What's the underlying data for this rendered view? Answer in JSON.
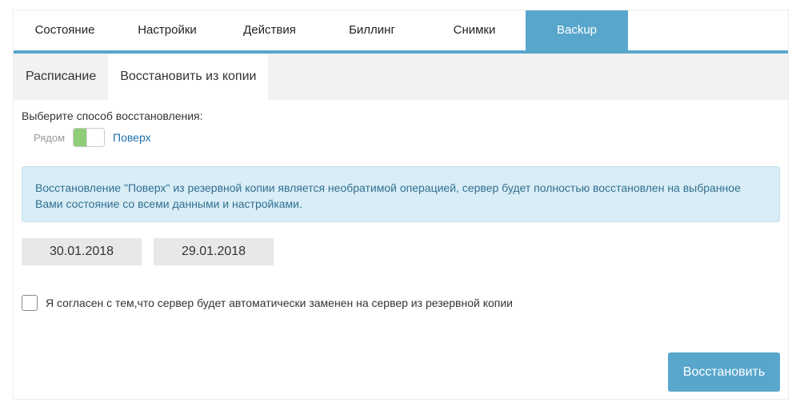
{
  "main_tabs": [
    {
      "label": "Состояние"
    },
    {
      "label": "Настройки"
    },
    {
      "label": "Действия"
    },
    {
      "label": "Биллинг"
    },
    {
      "label": "Снимки"
    },
    {
      "label": "Backup"
    }
  ],
  "active_main_tab": "Backup",
  "sub_tabs": [
    {
      "label": "Расписание"
    },
    {
      "label": "Восстановить из копии"
    }
  ],
  "active_sub_tab": "Восстановить из копии",
  "restore": {
    "method_label": "Выберите способ восстановления:",
    "toggle_off_label": "Рядом",
    "toggle_on_label": "Поверх",
    "toggle_state": "on",
    "alert_text": "Восстановление \"Поверх\" из резервной копии является необратимой операцией, сервер будет полностью восстановлен на выбранное Вами состояние со всеми данными и настройками.",
    "dates": [
      "30.01.2018",
      "29.01.2018"
    ],
    "agree_text": "Я согласен с тем,что сервер будет автоматически заменен на сервер из резервной копии",
    "agree_checked": false,
    "restore_button": "Восстановить"
  },
  "colors": {
    "accent": "#58a6cc",
    "toggle_on": "#8fcd79",
    "alert_bg": "#d9edf7",
    "alert_text": "#31708f",
    "link": "#1f6fab"
  }
}
